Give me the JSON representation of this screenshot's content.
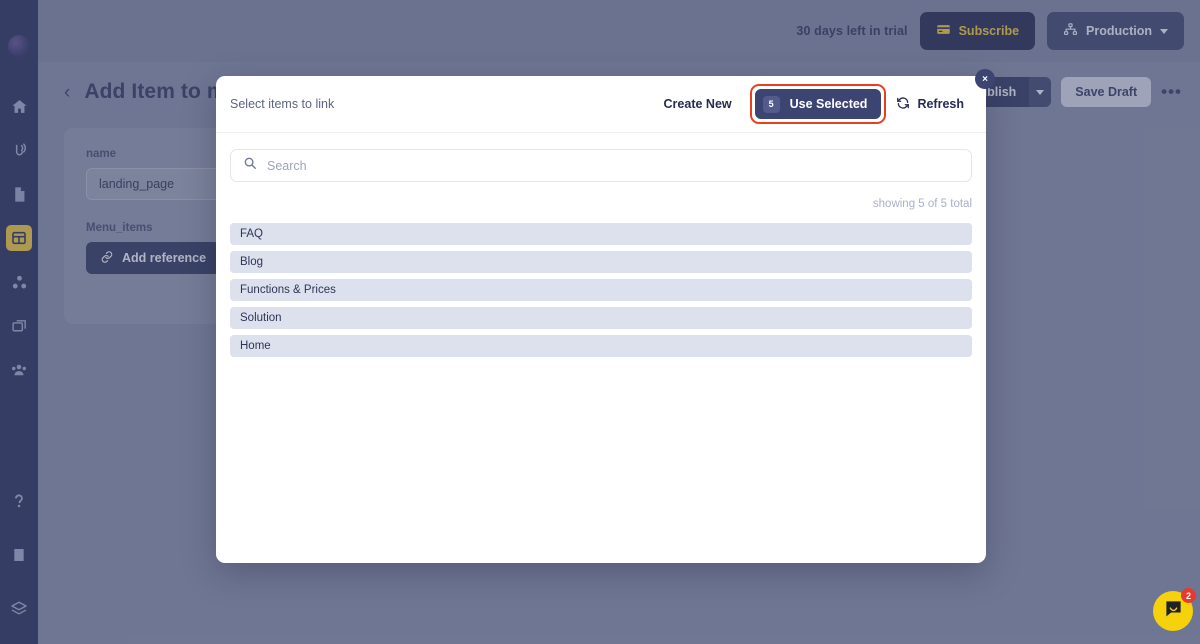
{
  "topbar": {
    "trial_text": "30 days left in trial",
    "subscribe_label": "Subscribe",
    "subscribe_icon": "credit-card-icon",
    "env_label": "Production",
    "env_icon": "sitemap-icon",
    "subscribe_bg": "#171d44",
    "subscribe_fg": "#e8c22e"
  },
  "sidebar": {
    "logo_icon": "app-logo-icon",
    "items": [
      {
        "icon": "home-icon",
        "active": false
      },
      {
        "icon": "broadcast-icon",
        "active": false
      },
      {
        "icon": "document-icon",
        "active": false
      },
      {
        "icon": "grid-icon",
        "active": true
      },
      {
        "icon": "blocks-icon",
        "active": false
      },
      {
        "icon": "media-icon",
        "active": false
      },
      {
        "icon": "users-icon",
        "active": false
      }
    ],
    "bottom_items": [
      {
        "icon": "help-icon"
      },
      {
        "icon": "book-icon"
      },
      {
        "icon": "layers-icon"
      }
    ],
    "active_color": "#e8c22e",
    "bg": "#1d2450"
  },
  "page": {
    "back_icon": "chevron-left-icon",
    "title": "Add Item to menu",
    "publish_label": "Publish",
    "publish_caret_icon": "chevron-down-icon",
    "save_draft_label": "Save Draft",
    "more_label": "•••",
    "form": {
      "name_label": "name",
      "name_value": "landing_page",
      "menu_items_label": "Menu_items",
      "add_reference_label": "Add reference",
      "add_reference_icon": "link-icon"
    }
  },
  "modal": {
    "title": "Select items to link",
    "close_icon": "close-icon",
    "close_label": "×",
    "create_new_label": "Create New",
    "use_selected_label": "Use Selected",
    "selected_count": "5",
    "refresh_label": "Refresh",
    "refresh_icon": "refresh-icon",
    "highlight_color": "#e8401f",
    "search": {
      "icon": "search-icon",
      "placeholder": "Search",
      "value": ""
    },
    "showing_count": "showing 5 of 5 total",
    "results": [
      {
        "label": "FAQ"
      },
      {
        "label": "Blog"
      },
      {
        "label": "Functions & Prices"
      },
      {
        "label": "Solution"
      },
      {
        "label": "Home"
      }
    ],
    "result_bg": "#dde1ed"
  },
  "chat": {
    "icon": "chat-bubble-icon",
    "badge_count": "2",
    "bg": "#f5d20c",
    "badge_bg": "#e8392f"
  }
}
